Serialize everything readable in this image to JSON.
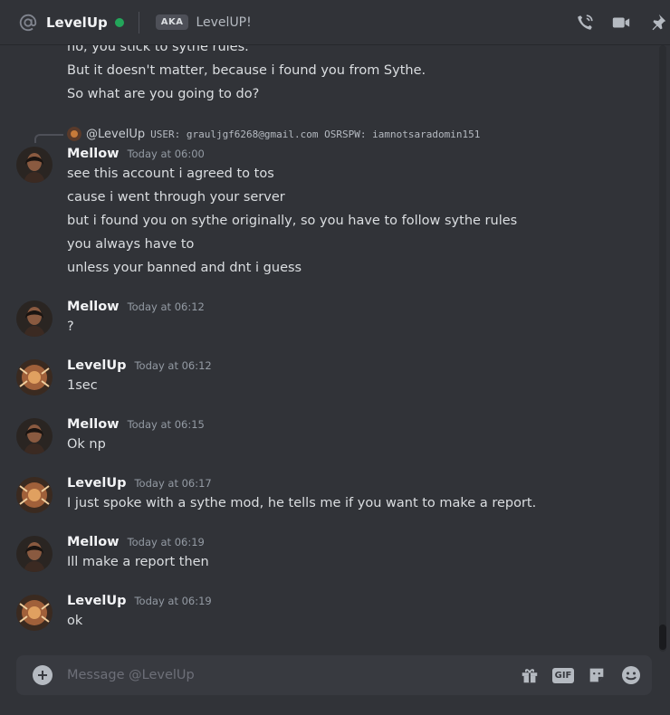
{
  "header": {
    "title": "LevelUp",
    "aka_label": "AKA",
    "aka_name": "LevelUP!",
    "icons": [
      "at-icon",
      "voice-call-icon",
      "video-call-icon",
      "pin-icon"
    ]
  },
  "reply": {
    "name": "@LevelUp",
    "text": "USER: grauljgf6268@gmail.com OSRSPW: iamnotsaradomin151"
  },
  "messages": {
    "top_lines": [
      "no, you stick to sythe rules.",
      "But it doesn't matter, because i found you from Sythe.",
      "So what are you going to do?"
    ],
    "g1": {
      "author": "Mellow",
      "time": "Today at 06:00",
      "lines": [
        "see this account i agreed to tos",
        "cause i went through your server",
        "but i found you on sythe originally, so you have to follow sythe rules",
        "you always have to",
        "unless your banned and dnt i guess"
      ]
    },
    "g2": {
      "author": "Mellow",
      "time": "Today at 06:12",
      "text": "?"
    },
    "g3": {
      "author": "LevelUp",
      "time": "Today at 06:12",
      "text": "1sec"
    },
    "g4": {
      "author": "Mellow",
      "time": "Today at 06:15",
      "text": "Ok np"
    },
    "g5": {
      "author": "LevelUp",
      "time": "Today at 06:17",
      "text": "I just spoke with a sythe mod, he tells me if you want to make a report."
    },
    "g6": {
      "author": "Mellow",
      "time": "Today at 06:19",
      "text": "Ill make a report then"
    },
    "g7": {
      "author": "LevelUp",
      "time": "Today at 06:19",
      "text": "ok"
    }
  },
  "composer": {
    "placeholder": "Message @LevelUp",
    "gif_label": "GIF",
    "icons": [
      "add-attachment-icon",
      "gift-icon",
      "gif-icon",
      "sticker-icon",
      "emoji-icon"
    ]
  },
  "colors": {
    "background": "#313338",
    "online": "#23a55a",
    "text": "#dbdee1",
    "muted": "#949ba4"
  }
}
